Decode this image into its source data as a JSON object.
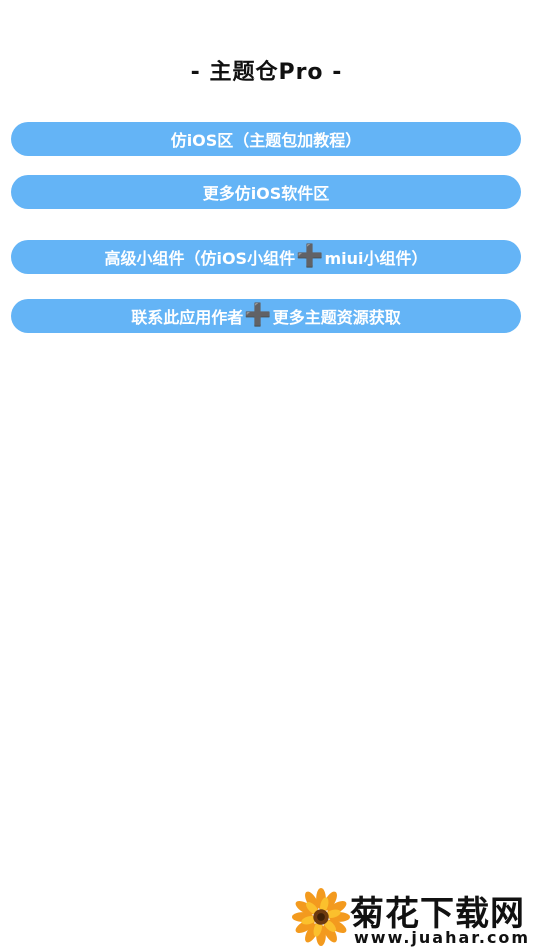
{
  "header": {
    "title": "- 主题仓Pro -"
  },
  "menu": [
    {
      "label": "仿iOS区（主题包加教程）"
    },
    {
      "label": "更多仿iOS软件区"
    },
    {
      "label_before": "高级小组件（仿iOS小组件",
      "label_after": "miui小组件）"
    },
    {
      "label_before": "联系此应用作者",
      "label_after": "更多主题资源获取"
    }
  ],
  "plus_symbol": "➕",
  "watermark": {
    "name": "菊花下载网",
    "url": "www.juahar.com",
    "icon": "flower-logo-icon"
  },
  "colors": {
    "button_bg": "#64b4f6",
    "button_text": "#ffffff",
    "plus_color": "#e8622c",
    "title_color": "#111111"
  }
}
